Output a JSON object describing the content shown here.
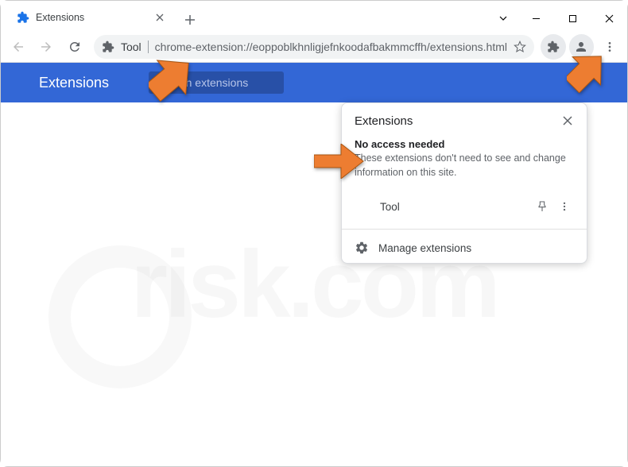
{
  "window": {
    "tab_title": "Extensions",
    "controls": {
      "chevron": "⌄",
      "min": "—",
      "max": "☐",
      "close": "✕"
    }
  },
  "toolbar": {
    "omnibox_tool": "Tool",
    "omnibox_url": "chrome-extension://eoppoblkhnligjefnkoodafbakmmcffh/extensions.html"
  },
  "page": {
    "title": "Extensions",
    "search_placeholder": "Search extensions"
  },
  "popup": {
    "title": "Extensions",
    "section_heading": "No access needed",
    "section_desc": "These extensions don't need to see and change information on this site.",
    "items": [
      {
        "name": "Tool"
      }
    ],
    "manage_label": "Manage extensions"
  },
  "watermark": {
    "text": "risk.com"
  }
}
